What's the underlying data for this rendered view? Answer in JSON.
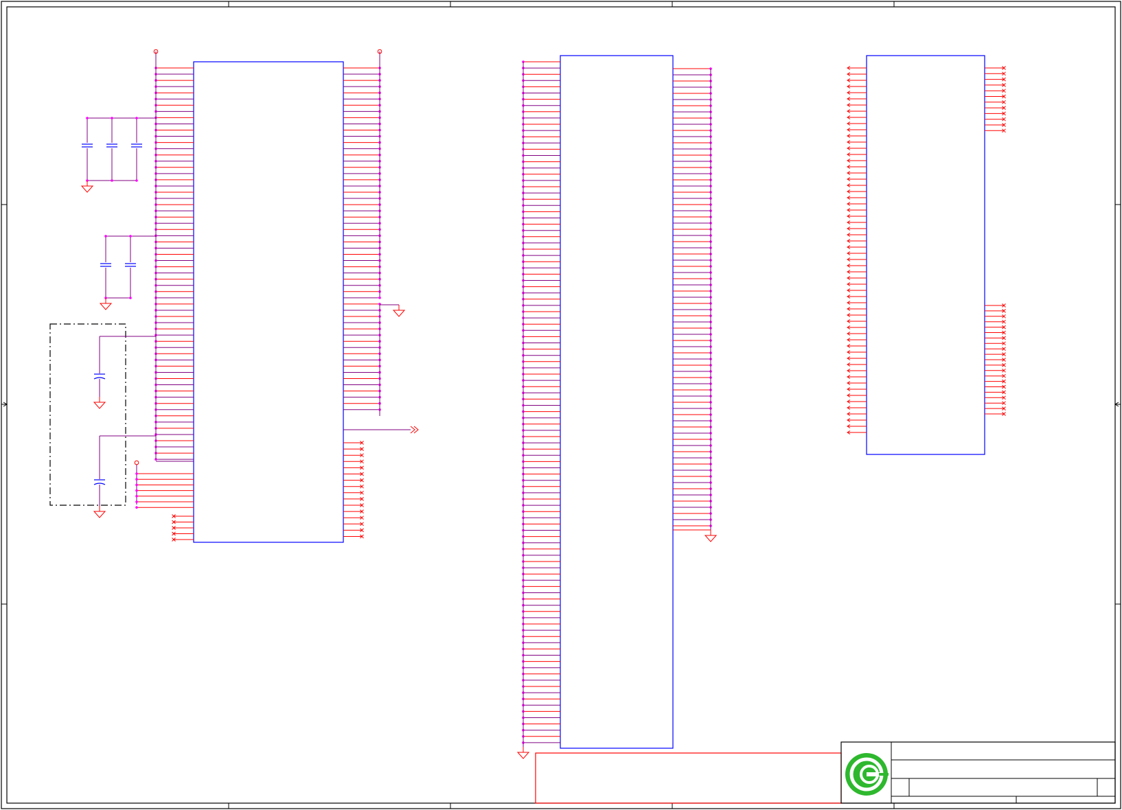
{
  "sheet": {
    "zone_columns": 5,
    "zone_rows": 4,
    "colors": {
      "border": "#000000",
      "component_body": "#0000ff",
      "pin": "#ff0000",
      "wire": "#800080",
      "junction": "#ff00ff",
      "capacitor": "#0000ff",
      "ground": "#ff0000",
      "power_port": "#ff0000",
      "no_connect": "#ff0000",
      "dashed_group": "#000000",
      "title_block": "#000000",
      "logo": "#2eb82e"
    }
  },
  "components": [
    {
      "id": "U1",
      "left_pins": 64,
      "right_pins": 76,
      "left_nc": 5,
      "right_nc": 16
    },
    {
      "id": "U2",
      "left_pins": 110,
      "right_pins": 75
    },
    {
      "id": "U3",
      "left_pins": 60,
      "right_nc": 33
    }
  ],
  "capacitor_groups": [
    {
      "id": "cap-group-1",
      "count": 3
    },
    {
      "id": "cap-group-2",
      "count": 2
    },
    {
      "id": "cap-group-3",
      "count": 2,
      "boundary": "dash-dot"
    }
  ],
  "title_block": {
    "logo_icon": "company-logo-icon"
  }
}
